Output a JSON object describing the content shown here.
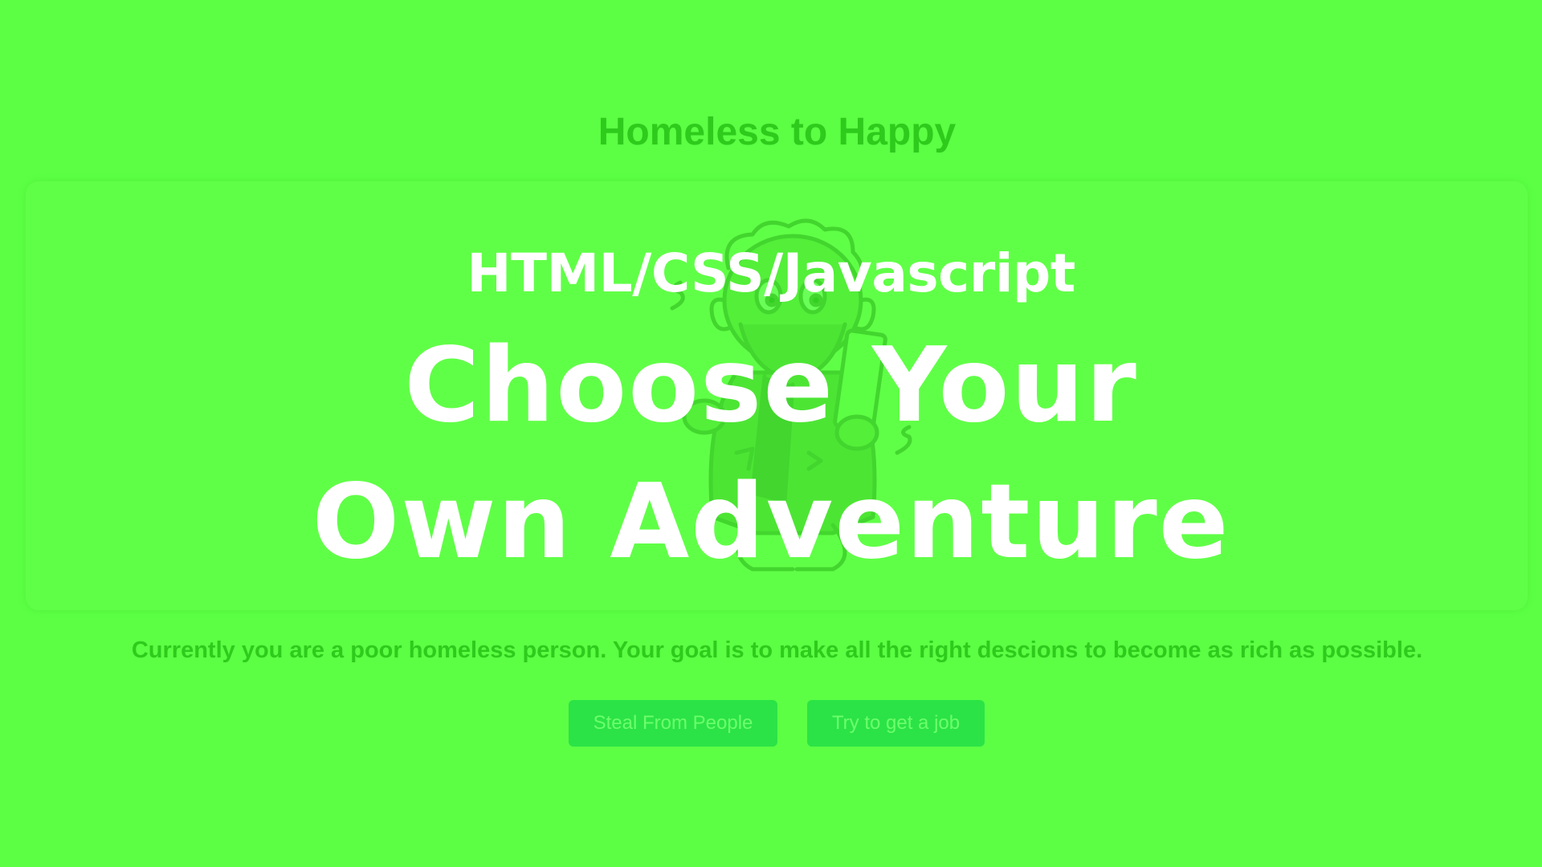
{
  "page": {
    "title": "Homeless to Happy",
    "background_color": "#5cff44"
  },
  "hero": {
    "subtitle": "HTML/CSS/Javascript",
    "heading_line1": "Choose Your",
    "heading_line2": "Own Adventure",
    "illustration_icon": "homeless-man-illustration"
  },
  "story": {
    "text": "Currently you are a poor homeless person. Your goal is to make all the right descions to become as rich as possible."
  },
  "choices": [
    {
      "label": "Steal From People"
    },
    {
      "label": "Try to get a job"
    }
  ],
  "colors": {
    "title_text": "#2ecb1c",
    "button_bg": "#2be347",
    "button_text": "#6cff6a",
    "hero_text": "#ffffff"
  }
}
